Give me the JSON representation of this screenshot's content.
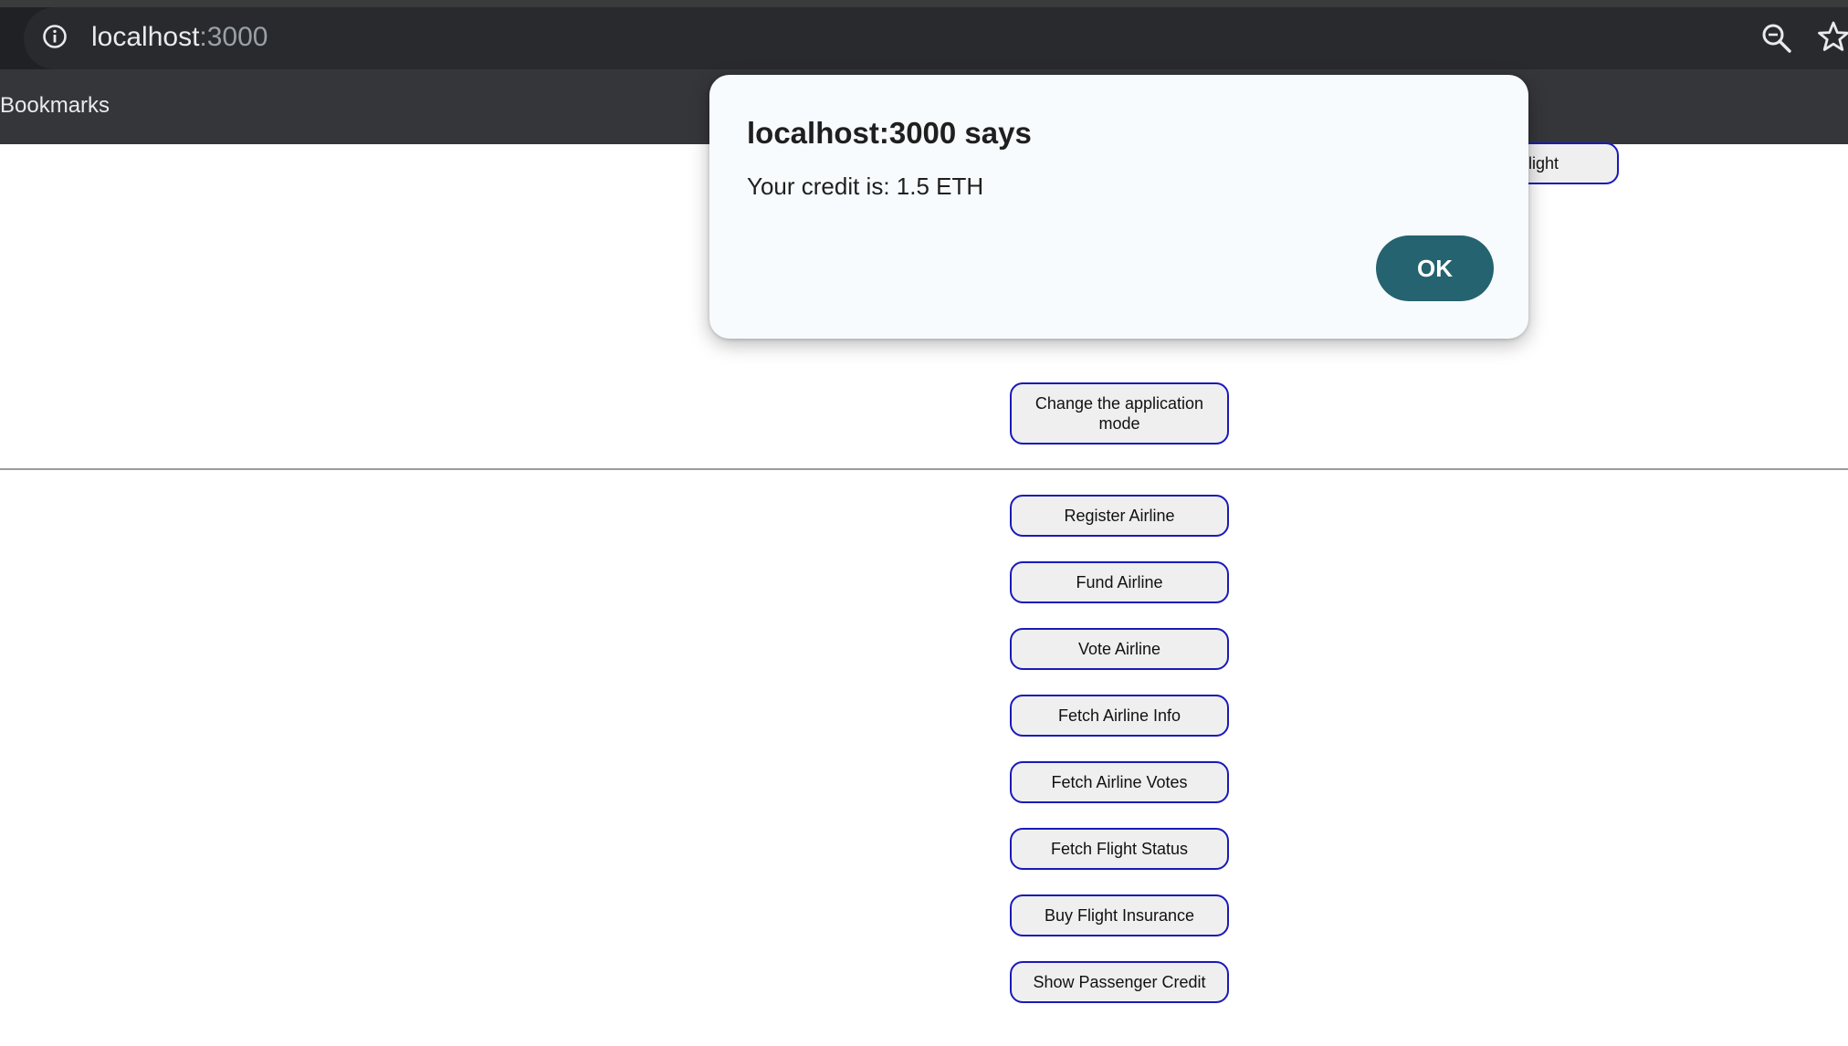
{
  "browser": {
    "url_host": "localhost",
    "url_port": ":3000",
    "bookmarks_label": "Bookmarks"
  },
  "page": {
    "partial_button_label": "light",
    "mode_button_label": "Change the application mode",
    "buttons": [
      "Register Airline",
      "Fund Airline",
      "Vote Airline",
      "Fetch Airline Info",
      "Fetch Airline Votes",
      "Fetch Flight Status",
      "Buy Flight Insurance",
      "Show Passenger Credit"
    ]
  },
  "dialog": {
    "title": "localhost:3000 says",
    "message": "Your credit is: 1.5 ETH",
    "ok_label": "OK"
  },
  "colors": {
    "toolbar": "#202124",
    "dialog_bg": "#f8fbfd",
    "ok_button": "#24636f",
    "button_border": "#1a1ab8"
  },
  "icons": {
    "info": "info-icon",
    "zoom": "zoom-icon",
    "bookmark": "star-icon"
  }
}
